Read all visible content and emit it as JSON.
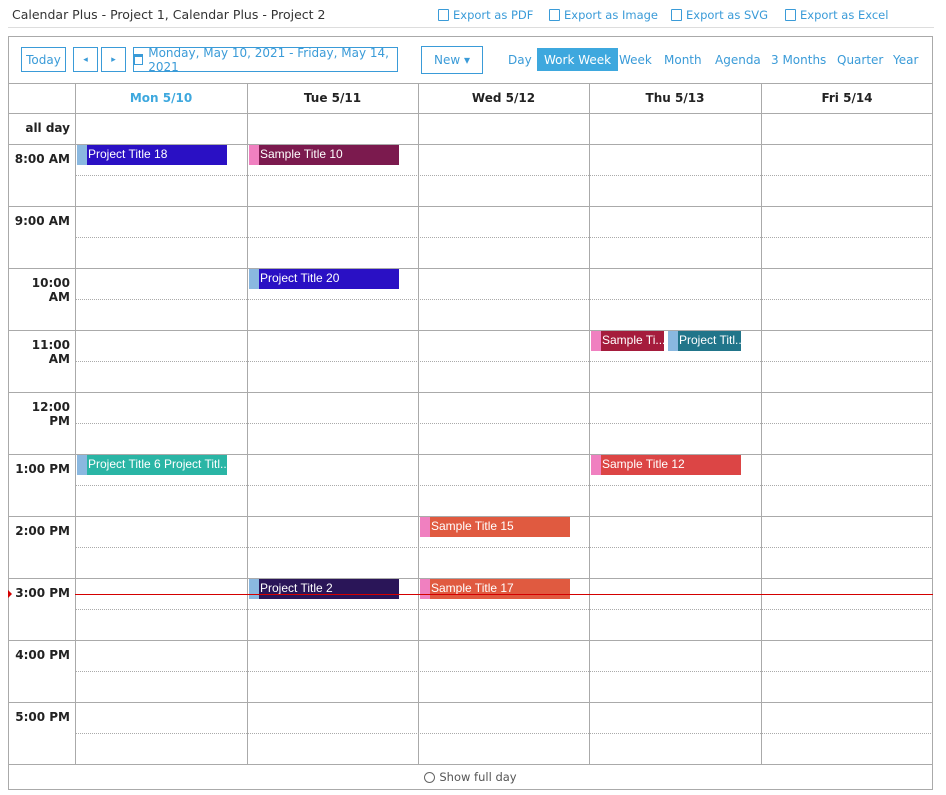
{
  "app_title": "Calendar Plus - Project 1, Calendar Plus - Project 2",
  "exports": [
    {
      "label": "Export as PDF",
      "icon": "pdf-icon"
    },
    {
      "label": "Export as Image",
      "icon": "image-icon"
    },
    {
      "label": "Export as SVG",
      "icon": "svg-icon"
    },
    {
      "label": "Export as Excel",
      "icon": "excel-icon"
    }
  ],
  "toolbar": {
    "today": "Today",
    "prev": "◂",
    "next": "▸",
    "date_range": "Monday, May 10, 2021 - Friday, May 14, 2021",
    "new": "New ▾"
  },
  "views": [
    {
      "label": "Day"
    },
    {
      "label": "Work Week",
      "active": true
    },
    {
      "label": "Week"
    },
    {
      "label": "Month"
    },
    {
      "label": "Agenda"
    },
    {
      "label": "3 Months"
    },
    {
      "label": "Quarter"
    },
    {
      "label": "Year"
    }
  ],
  "days": [
    {
      "label": "Mon 5/10",
      "today": true
    },
    {
      "label": "Tue 5/11"
    },
    {
      "label": "Wed 5/12"
    },
    {
      "label": "Thu 5/13"
    },
    {
      "label": "Fri 5/14"
    }
  ],
  "all_day_label": "all day",
  "hours": [
    "8:00 AM",
    "9:00 AM",
    "10:00 AM",
    "11:00 AM",
    "12:00 PM",
    "1:00 PM",
    "2:00 PM",
    "3:00 PM",
    "4:00 PM",
    "5:00 PM"
  ],
  "current_time": "3:15 PM",
  "colors": {
    "accent": "#3ea8de",
    "now_line": "#d40000",
    "project_stripe": "#8ab8e0",
    "sample_stripe": "#f080c0"
  },
  "events": [
    {
      "title": "Project Title 18",
      "day": 0,
      "start": "8:00 AM",
      "color": "#2a10c4",
      "stripe": "#8ab8e0"
    },
    {
      "title": "Sample Title 10",
      "day": 1,
      "start": "8:00 AM",
      "color": "#7b1a4e",
      "stripe": "#f080c0"
    },
    {
      "title": "Project Title 20",
      "day": 1,
      "start": "10:00 AM",
      "color": "#2a10c4",
      "stripe": "#8ab8e0"
    },
    {
      "title": "Sample Ti...",
      "day": 3,
      "start": "11:00 AM",
      "color": "#a51c3c",
      "stripe": "#f080c0",
      "col": 0,
      "cols": 2
    },
    {
      "title": "Project Titl...",
      "day": 3,
      "start": "11:00 AM",
      "color": "#21758a",
      "stripe": "#8ab8e0",
      "col": 1,
      "cols": 2
    },
    {
      "title": "Project Title 6 Project Titl...",
      "day": 0,
      "start": "1:00 PM",
      "color": "#2ab5a5",
      "stripe": "#8ab8e0"
    },
    {
      "title": "Sample Title 12",
      "day": 3,
      "start": "1:00 PM",
      "color": "#dc4545",
      "stripe": "#f080c0"
    },
    {
      "title": "Sample Title 15",
      "day": 2,
      "start": "2:00 PM",
      "color": "#e05a40",
      "stripe": "#f080c0"
    },
    {
      "title": "Project Title 2",
      "day": 1,
      "start": "3:00 PM",
      "color": "#2a1558",
      "stripe": "#8ab8e0"
    },
    {
      "title": "Sample Title 17",
      "day": 2,
      "start": "3:00 PM",
      "color": "#e05a40",
      "stripe": "#f080c0"
    }
  ],
  "footer": {
    "label": "Show full day",
    "icon": "clock-icon"
  }
}
